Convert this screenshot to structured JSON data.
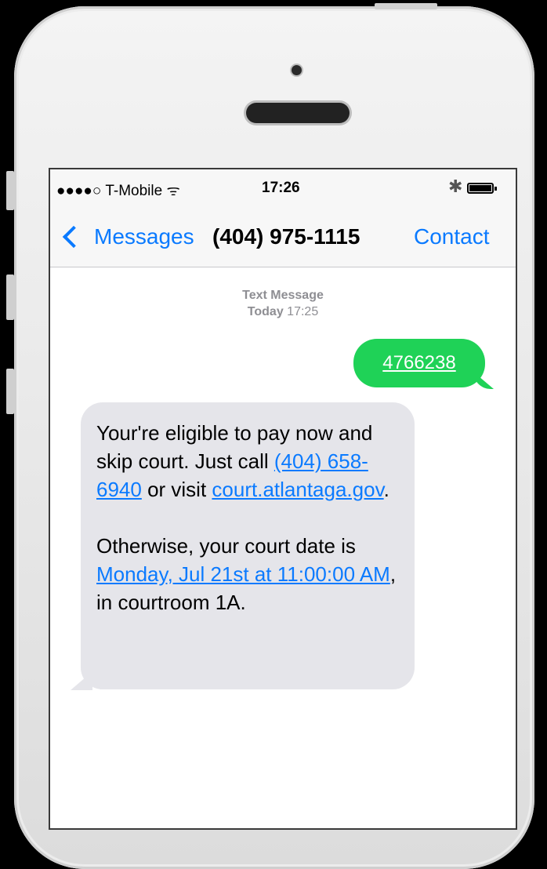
{
  "status_bar": {
    "carrier": "●●●●○ T-Mobile ᯤ",
    "time": "17:26",
    "bluetooth_icon": "bluetooth-icon",
    "battery_icon": "battery-icon"
  },
  "nav": {
    "back_label": "Messages",
    "title": "(404) 975-1115",
    "contact_label": "Contact"
  },
  "thread": {
    "header_line1": "Text Message",
    "header_day": "Today",
    "header_time": "17:25"
  },
  "messages": {
    "sent_text": "4766238",
    "recv_p1_a": "Your're eligible to pay now and skip court. Just call ",
    "recv_p1_phone": "(404) 658-6940",
    "recv_p1_b": " or visit ",
    "recv_p1_url": "court.atlantaga.gov",
    "recv_p1_c": ".",
    "recv_p2_a": "Otherwise, your court date is ",
    "recv_p2_date": "Monday, Jul 21st at 11:00:00 AM",
    "recv_p2_b": ", in courtroom 1A."
  },
  "colors": {
    "accent": "#0a7aff",
    "sent_bubble": "#1fd257",
    "received_bubble": "#e5e5ea"
  }
}
